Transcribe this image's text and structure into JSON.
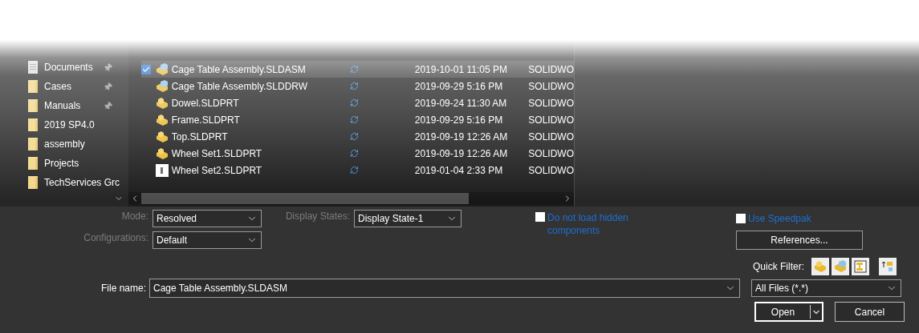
{
  "sidebar": {
    "items": [
      {
        "label": "Documents",
        "kind": "documents",
        "pinned": true
      },
      {
        "label": "Cases",
        "kind": "folder",
        "pinned": true
      },
      {
        "label": "Manuals",
        "kind": "folder",
        "pinned": true
      },
      {
        "label": "2019 SP4.0",
        "kind": "folder",
        "pinned": false
      },
      {
        "label": "assembly",
        "kind": "folder",
        "pinned": false
      },
      {
        "label": "Projects",
        "kind": "folder",
        "pinned": false
      },
      {
        "label": "TechServices Grc",
        "kind": "folder",
        "pinned": false
      }
    ]
  },
  "files": [
    {
      "name": "Cage Table Assembly.SLDASM",
      "kind": "assembly",
      "date": "2019-10-01 11:05 PM",
      "type": "SOLIDWO",
      "selected": true
    },
    {
      "name": "Cage Table Assembly.SLDDRW",
      "kind": "drawing",
      "date": "2019-09-29 5:16 PM",
      "type": "SOLIDWO",
      "selected": false
    },
    {
      "name": "Dowel.SLDPRT",
      "kind": "part",
      "date": "2019-09-24 11:30 AM",
      "type": "SOLIDWO",
      "selected": false
    },
    {
      "name": "Frame.SLDPRT",
      "kind": "part",
      "date": "2019-09-29 5:16 PM",
      "type": "SOLIDWO",
      "selected": false
    },
    {
      "name": "Top.SLDPRT",
      "kind": "part",
      "date": "2019-09-19 12:26 AM",
      "type": "SOLIDWO",
      "selected": false
    },
    {
      "name": "Wheel Set1.SLDPRT",
      "kind": "part",
      "date": "2019-09-19 12:26 AM",
      "type": "SOLIDWO",
      "selected": false
    },
    {
      "name": "Wheel Set2.SLDPRT",
      "kind": "preview",
      "date": "2019-01-04 2:33 PM",
      "type": "SOLIDWO",
      "selected": false
    }
  ],
  "options": {
    "mode": {
      "label": "Mode:",
      "value": "Resolved"
    },
    "configurations": {
      "label": "Configurations:",
      "value": "Default"
    },
    "display_states": {
      "label": "Display States:",
      "value": "Display State-1"
    },
    "hidden_components": {
      "label": "Do not load hidden components",
      "checked": false
    },
    "speedpak": {
      "label": "Use Speedpak",
      "checked": false
    },
    "references_button": "References...",
    "quick_filter": "Quick Filter:"
  },
  "file_name": {
    "label": "File name:",
    "value": "Cage Table Assembly.SLDASM"
  },
  "file_type": "All Files (*.*)",
  "buttons": {
    "open": "Open",
    "cancel": "Cancel"
  }
}
